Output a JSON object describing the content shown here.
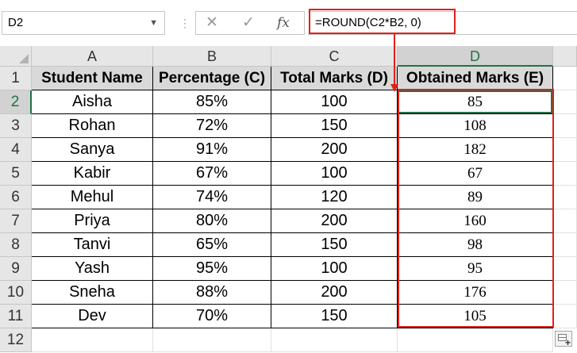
{
  "name_box": {
    "value": "D2"
  },
  "formula_bar": {
    "cancel_glyph": "✕",
    "enter_glyph": "✓",
    "fx_label": "fx",
    "formula": "=ROUND(C2*B2, 0)"
  },
  "columns": [
    "A",
    "B",
    "C",
    "D"
  ],
  "selected_column": "D",
  "row_numbers": [
    "1",
    "2",
    "3",
    "4",
    "5",
    "6",
    "7",
    "8",
    "9",
    "10",
    "11",
    "12"
  ],
  "selected_row": "2",
  "headers": [
    "Student Name",
    "Percentage (C)",
    "Total Marks (D)",
    "Obtained Marks (E)"
  ],
  "rows": [
    [
      "Aisha",
      "85%",
      "100",
      "85"
    ],
    [
      "Rohan",
      "72%",
      "150",
      "108"
    ],
    [
      "Sanya",
      "91%",
      "200",
      "182"
    ],
    [
      "Kabir",
      "67%",
      "100",
      "67"
    ],
    [
      "Mehul",
      "74%",
      "120",
      "89"
    ],
    [
      "Priya",
      "80%",
      "200",
      "160"
    ],
    [
      "Tanvi",
      "65%",
      "150",
      "98"
    ],
    [
      "Yash",
      "95%",
      "100",
      "95"
    ],
    [
      "Sneha",
      "88%",
      "200",
      "176"
    ],
    [
      "Dev",
      "70%",
      "150",
      "105"
    ]
  ],
  "colors": {
    "highlight_red": "#e0201b",
    "selection_green": "#217346",
    "header_fill": "#d9d9d9"
  }
}
